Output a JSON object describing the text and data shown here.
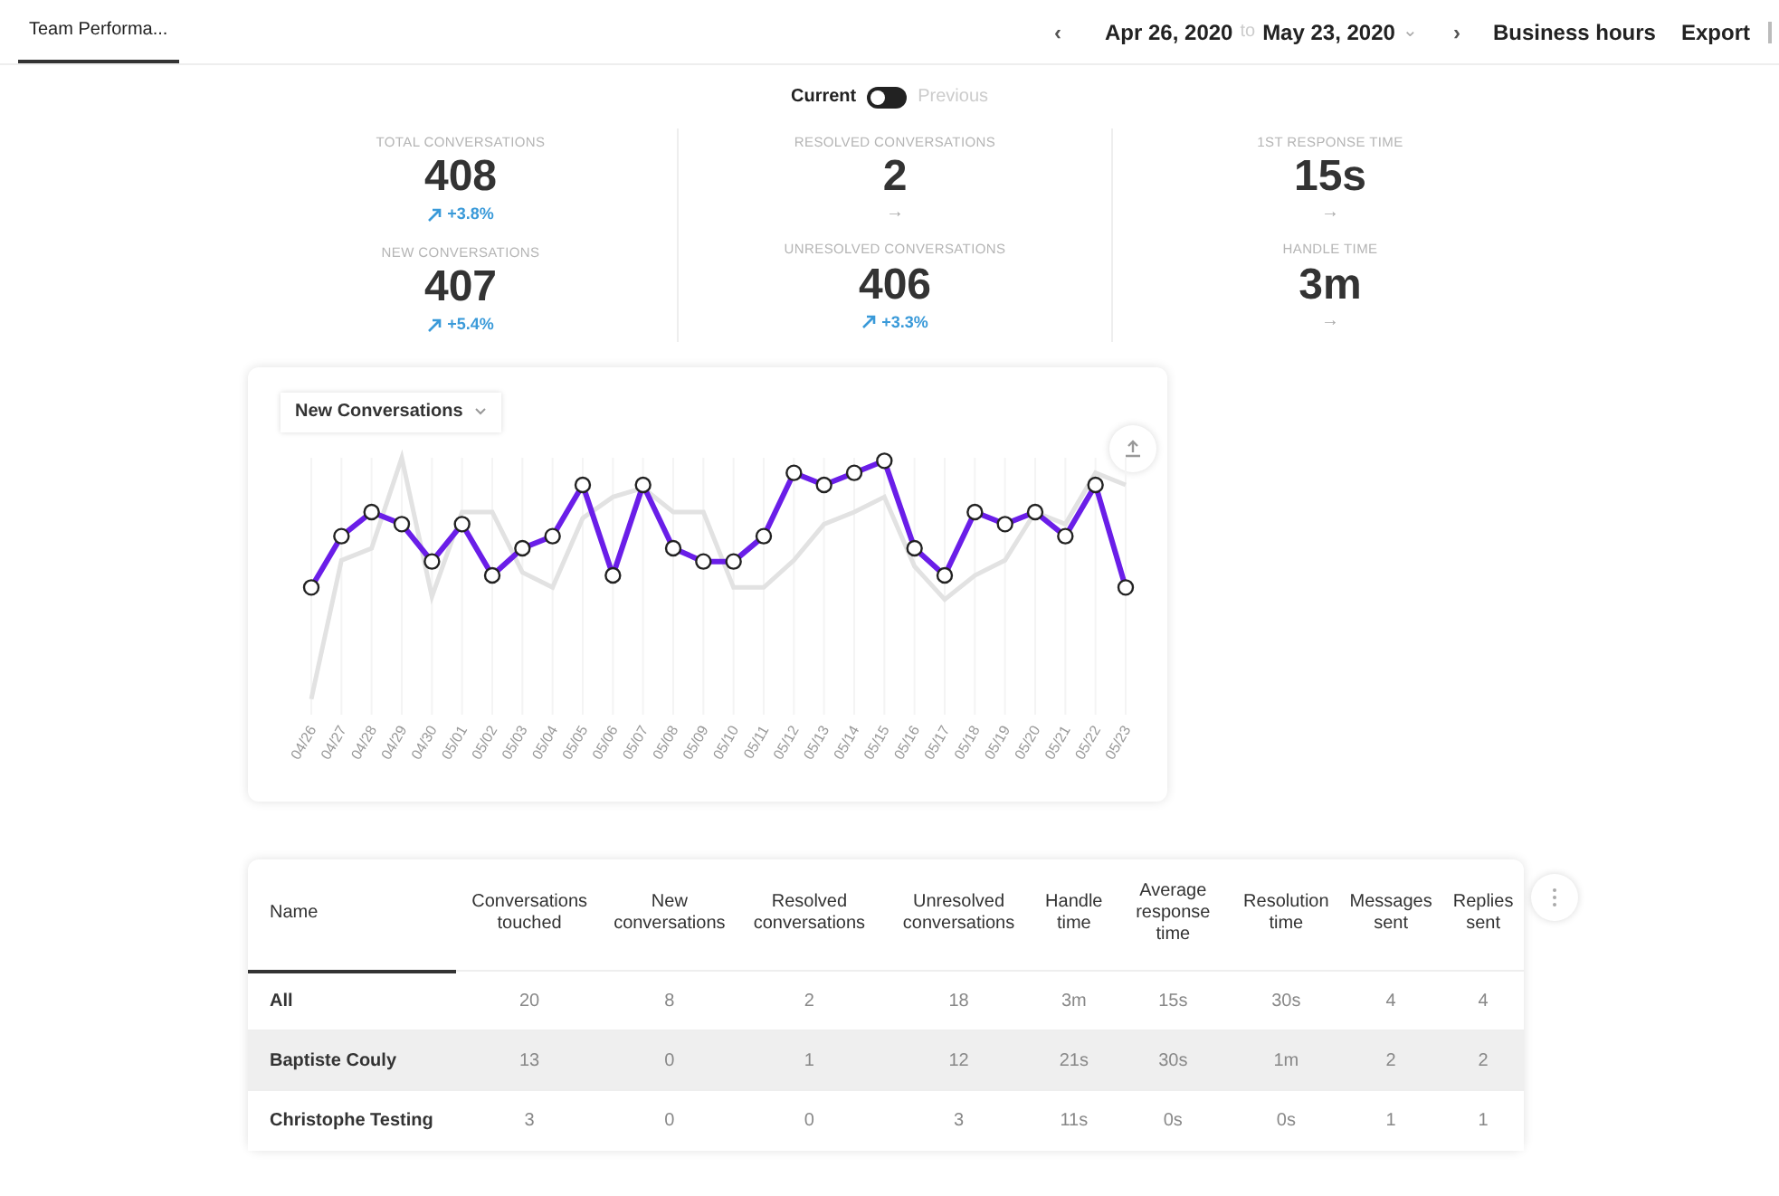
{
  "tabs": [
    {
      "label": "Team Performa...",
      "selected": true
    }
  ],
  "header": {
    "prev": "‹",
    "date_from": "Apr 26, 2020",
    "date_sep": "to",
    "date_to": "May 23, 2020",
    "date_caret": "⌄",
    "next": "›",
    "business_hours": "Business hours",
    "export": "Export"
  },
  "period_toggle": {
    "current_label": "Current",
    "previous_label": "Previous",
    "on": false
  },
  "stat_columns": [
    [
      {
        "label": "TOTAL CONVERSATIONS",
        "value": "408",
        "kind": "up",
        "change": "+3.8%"
      },
      {
        "label": "NEW CONVERSATIONS",
        "value": "407",
        "kind": "up",
        "change": "+5.4%"
      }
    ],
    [
      {
        "label": "RESOLVED CONVERSATIONS",
        "value": "2",
        "kind": "flat",
        "change": "→"
      },
      {
        "label": "UNRESOLVED CONVERSATIONS",
        "value": "406",
        "kind": "up",
        "change": "+3.3%"
      }
    ],
    [
      {
        "label": "1ST RESPONSE TIME",
        "value": "15s",
        "kind": "flat",
        "change": "→"
      },
      {
        "label": "HANDLE TIME",
        "value": "3m",
        "kind": "flat",
        "change": "→"
      }
    ]
  ],
  "chart": {
    "metric_select": "New Conversations",
    "x_labels": [
      "04/26",
      "04/27",
      "04/28",
      "04/29",
      "04/30",
      "05/01",
      "05/02",
      "05/03",
      "05/04",
      "05/05",
      "05/06",
      "05/07",
      "05/08",
      "05/09",
      "05/10",
      "05/11",
      "05/12",
      "05/13",
      "05/14",
      "05/15",
      "05/16",
      "05/17",
      "05/18",
      "05/19",
      "05/20",
      "05/21",
      "05/22",
      "05/23"
    ]
  },
  "table": {
    "columns": [
      "Name",
      "Conversations touched",
      "New conversations",
      "Resolved conversations",
      "Unresolved conversations",
      "Handle time",
      "Average response time",
      "Resolution time",
      "Messages sent",
      "Replies sent"
    ],
    "sorted": [
      true,
      false,
      false,
      false,
      false,
      false,
      false,
      false,
      false,
      false
    ],
    "rows": [
      {
        "cells": [
          "All",
          "20",
          "8",
          "2",
          "18",
          "3m",
          "15s",
          "30s",
          "4",
          "4"
        ],
        "highlighted": false
      },
      {
        "cells": [
          "Baptiste Couly",
          "13",
          "0",
          "1",
          "12",
          "21s",
          "30s",
          "1m",
          "2",
          "2"
        ],
        "highlighted": true
      },
      {
        "cells": [
          "Christophe Testing",
          "3",
          "0",
          "0",
          "3",
          "11s",
          "0s",
          "0s",
          "1",
          "1"
        ],
        "highlighted": false
      }
    ]
  }
}
